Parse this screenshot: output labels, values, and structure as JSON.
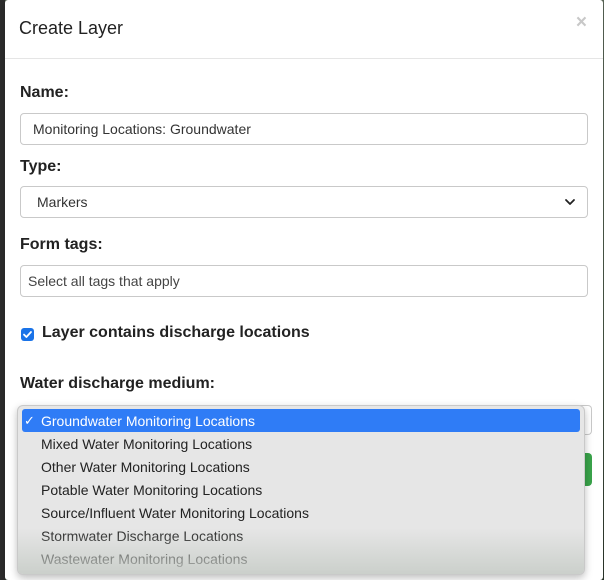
{
  "modal": {
    "title": "Create Layer",
    "close_icon": "×"
  },
  "form": {
    "name_label": "Name:",
    "name_value": "Monitoring Locations: Groundwater",
    "type_label": "Type:",
    "type_value": "Markers",
    "tags_label": "Form tags:",
    "tags_placeholder": "Select all tags that apply",
    "discharge_checkbox_label": "Layer contains discharge locations",
    "discharge_checked": true,
    "medium_label": "Water discharge medium:"
  },
  "dropdown": {
    "options": [
      "Groundwater Monitoring Locations",
      "Mixed Water Monitoring Locations",
      "Other Water Monitoring Locations",
      "Potable Water Monitoring Locations",
      "Source/Influent Water Monitoring Locations",
      "Stormwater Discharge Locations",
      "Wastewater Monitoring Locations"
    ],
    "selected_index": 0,
    "check_mark": "✓"
  },
  "colors": {
    "accent": "#2f7cf6",
    "checkbox": "#1a73e8",
    "submit": "#39a34a"
  }
}
